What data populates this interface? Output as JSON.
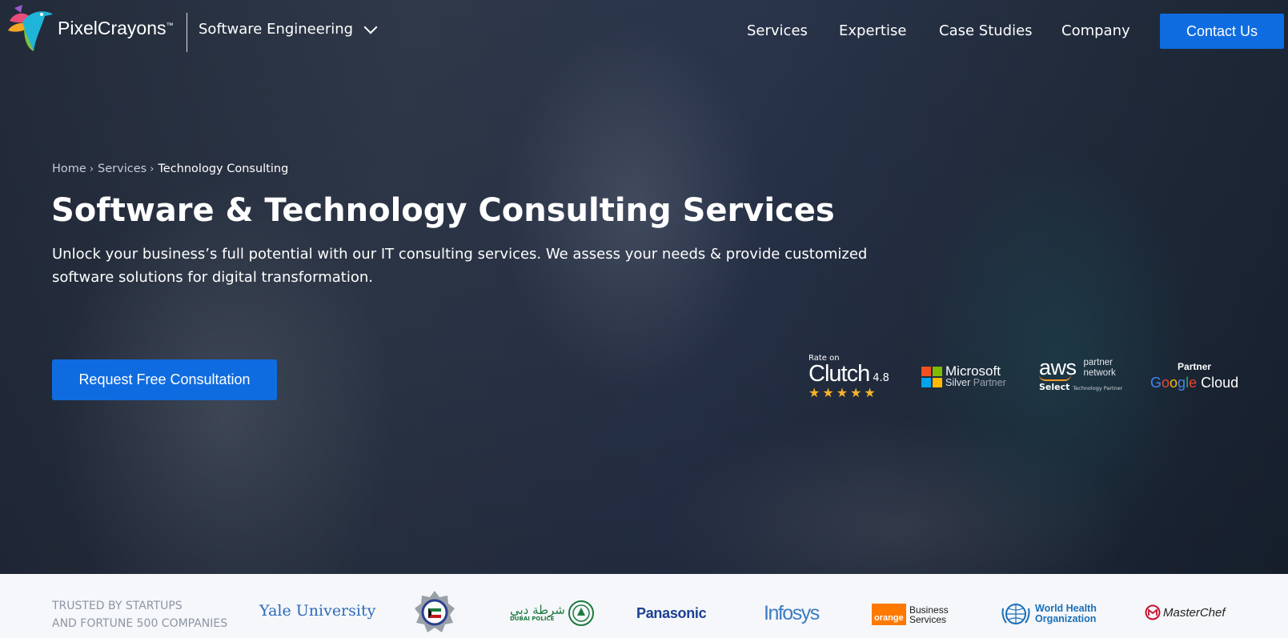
{
  "header": {
    "brand": "PixelCrayons",
    "brand_tm": "™",
    "domain_select": "Software Engineering",
    "nav": [
      {
        "label": "Services"
      },
      {
        "label": "Expertise"
      },
      {
        "label": "Case Studies"
      },
      {
        "label": "Company"
      }
    ],
    "contact_label": "Contact Us"
  },
  "breadcrumb": [
    {
      "label": "Home"
    },
    {
      "label": "Services"
    },
    {
      "label": "Technology Consulting"
    }
  ],
  "hero": {
    "title": "Software & Technology Consulting Services",
    "description": "Unlock your business’s full potential with our IT consulting services. We assess your needs & provide customized software solutions for digital transformation.",
    "cta_label": "Request Free Consultation"
  },
  "badges": {
    "clutch": {
      "rate_on": "Rate on",
      "name": "Clutch",
      "score": "4.8",
      "stars": "★★★★★",
      "star_color": "#f7b32b"
    },
    "microsoft": {
      "name": "Microsoft",
      "tier": "Silver",
      "partner": "Partner"
    },
    "aws": {
      "name": "aws",
      "partner_line1": "partner",
      "partner_line2": "network",
      "select": "Select",
      "select_sub": "Technology Partner"
    },
    "google": {
      "partner": "Partner",
      "name_google": "Google",
      "name_cloud": "Cloud"
    }
  },
  "trusted": {
    "label_line1": "TRUSTED BY STARTUPS",
    "label_line2": "AND FORTUNE 500 COMPANIES",
    "clients": {
      "yale": "Yale University",
      "dubai_ar": "شرطة دبي",
      "dubai_en": "DUBAI POLICE",
      "panasonic": "Panasonic",
      "infosys": "Infosys",
      "orange_sq": "orange",
      "orange_line1": "Business",
      "orange_line2": "Services",
      "who_line1": "World Health",
      "who_line2": "Organization",
      "masterchef": "MasterChef"
    }
  },
  "colors": {
    "accent": "#0f6ce0",
    "hero_overlay": "#1f2a38",
    "strip_bg": "#f5f7fa",
    "muted_text": "#8e96a2"
  }
}
